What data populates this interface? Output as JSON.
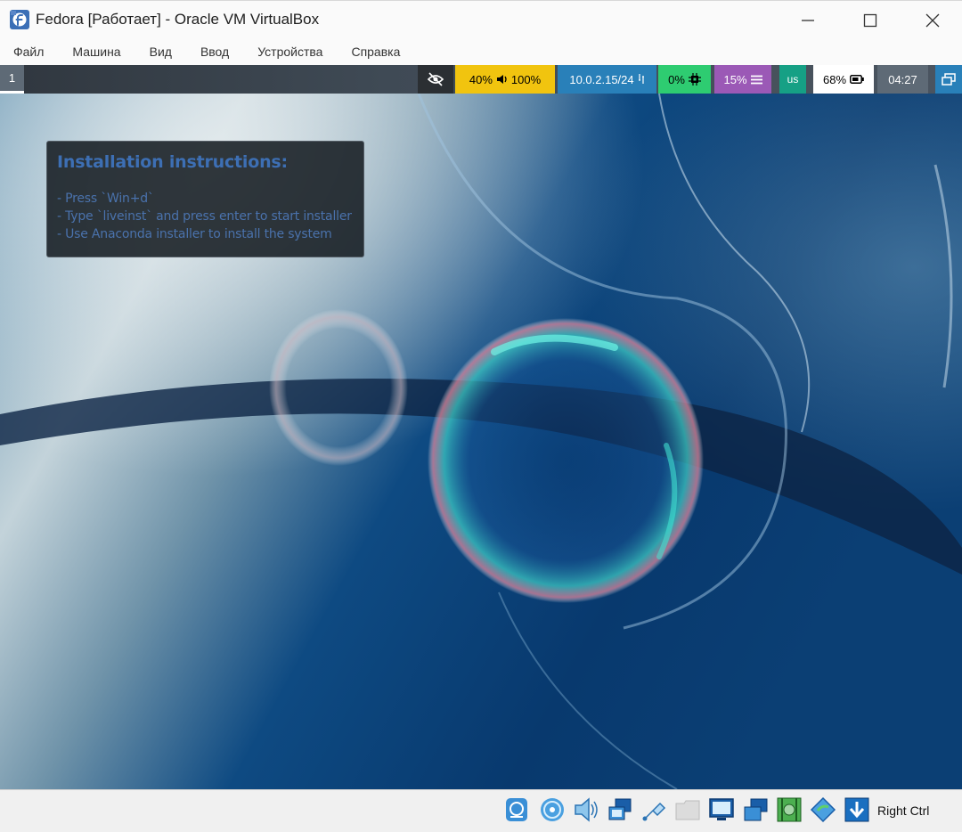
{
  "window": {
    "title": "Fedora [Работает] - Oracle VM VirtualBox",
    "app_icon": "fedora-logo-icon",
    "controls": [
      "minimize-icon",
      "maximize-icon",
      "close-icon"
    ]
  },
  "menu": {
    "items": [
      "Файл",
      "Машина",
      "Вид",
      "Ввод",
      "Устройства",
      "Справка"
    ]
  },
  "guest_bar": {
    "workspace": "1",
    "modules": {
      "idle_inhibitor": {
        "icon": "eye-slash-icon"
      },
      "backlight": {
        "value": "40%"
      },
      "volume": {
        "value": "100%",
        "icon": "speaker-icon"
      },
      "network": {
        "value": "10.0.2.15/24",
        "icon": "ethernet-icon"
      },
      "cpu": {
        "value": "0%",
        "icon": "cpu-chip-icon"
      },
      "memory": {
        "value": "15%",
        "icon": "memory-icon"
      },
      "keyboard": {
        "value": "us"
      },
      "battery": {
        "value": "68%",
        "icon": "battery-icon"
      },
      "clock": {
        "value": "04:27"
      },
      "tray": {
        "icon": "window-icon"
      }
    },
    "colors": {
      "backlight": "#f1c40f",
      "network": "#2980b9",
      "cpu": "#2ecc71",
      "memory": "#9b59b6",
      "keyboard": "#16a085",
      "battery": "#ffffff",
      "clock": "#5e6a76"
    }
  },
  "desktop": {
    "notice": {
      "title": "Installation instructions:",
      "lines": [
        "- Press `Win+d`",
        "- Type `liveinst` and press enter to start installer",
        "- Use Anaconda installer to install the system"
      ]
    }
  },
  "status_bar": {
    "icons": [
      "hard-disk-icon",
      "optical-disk-icon",
      "audio-icon",
      "network-icon",
      "usb-icon",
      "shared-folder-icon",
      "display-icon",
      "recording-icon",
      "cpu-icon",
      "mouse-integration-icon",
      "keyboard-capture-icon"
    ],
    "host_key": "Right Ctrl"
  }
}
